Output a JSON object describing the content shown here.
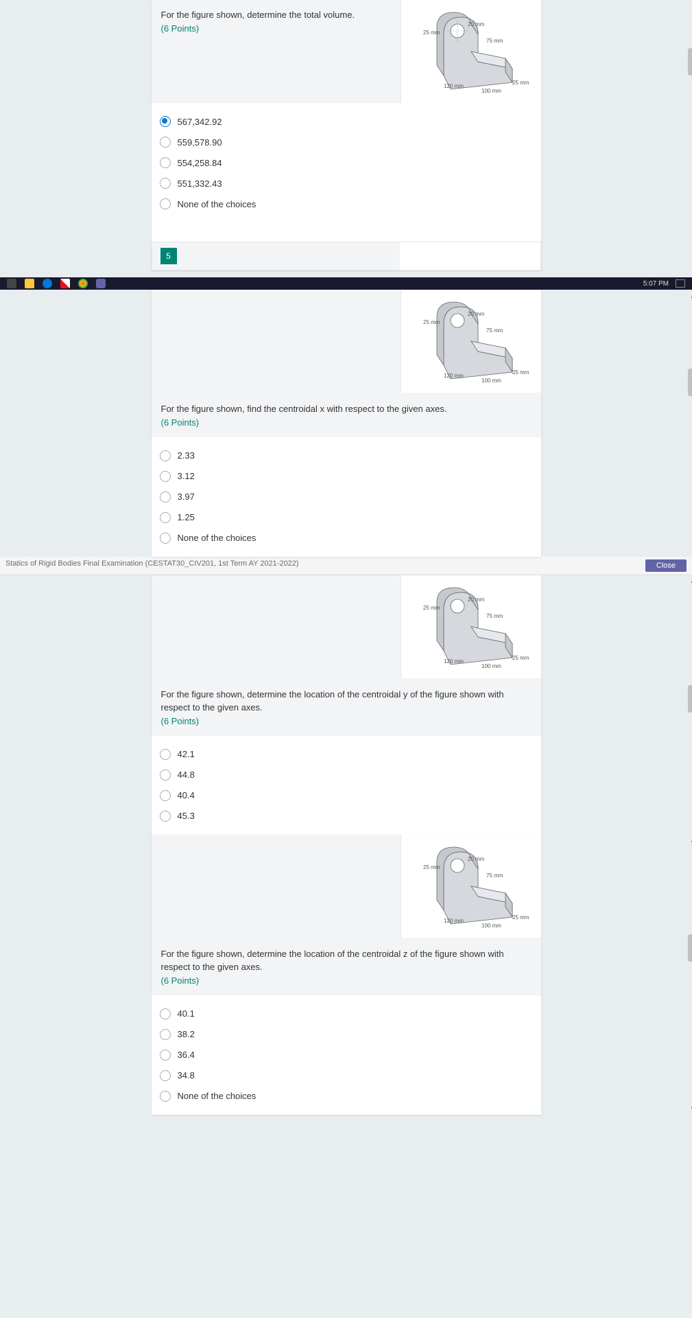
{
  "questions": [
    {
      "prompt": "For the figure shown, determine the total volume.",
      "points": "(6 Points)",
      "options": [
        "567,342.92",
        "559,578.90",
        "554,258.84",
        "551,332.43",
        "None of the choices"
      ],
      "selected": 0,
      "number": "5"
    },
    {
      "prompt": "For the figure shown, find the centroidal x with respect to the given axes.",
      "points": "(6 Points)",
      "options": [
        "2.33",
        "3.12",
        "3.97",
        "1.25",
        "None of the choices"
      ],
      "selected": null
    },
    {
      "prompt": "For the figure shown, determine the location of the centroidal y of the figure shown with respect to the given axes.",
      "points": "(6 Points)",
      "options": [
        "42.1",
        "44.8",
        "40.4",
        "45.3"
      ],
      "selected": null
    },
    {
      "prompt": "For the figure shown, determine the location of the centroidal z of the figure shown with respect to the given axes.",
      "points": "(6 Points)",
      "options": [
        "40.1",
        "38.2",
        "36.4",
        "34.8",
        "None of the choices"
      ],
      "selected": null
    }
  ],
  "figure": {
    "dims": [
      "25 mm",
      "20 mm",
      "75 mm",
      "120 mm",
      "100 mm",
      "25 mm"
    ]
  },
  "header": {
    "title": "Statics of Rigid Bodies Final Examination (CESTAT30_CIV201, 1st Term AY 2021-2022)",
    "close": "Close"
  },
  "taskbar": {
    "time": "5:07 PM"
  }
}
